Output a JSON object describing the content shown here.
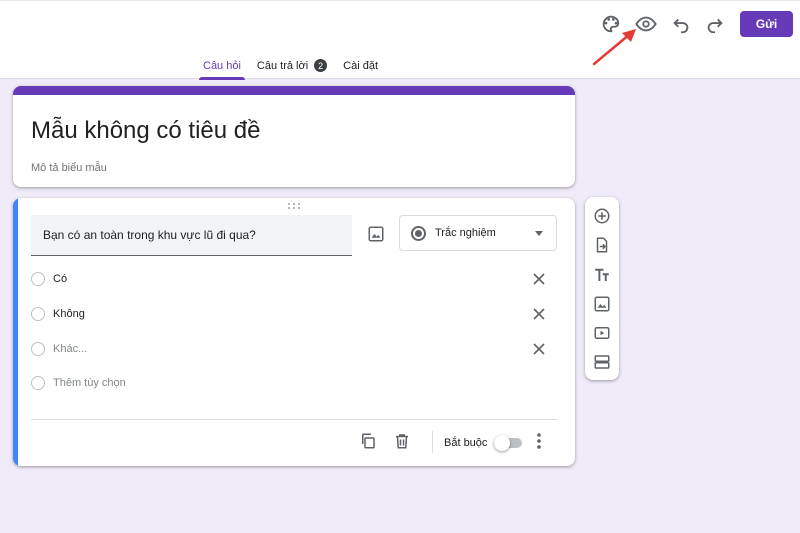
{
  "header": {
    "send_label": "Gửi",
    "tabs": [
      {
        "label": "Câu hỏi",
        "active": true
      },
      {
        "label": "Câu trả lời",
        "badge": "2"
      },
      {
        "label": "Cài đặt"
      }
    ],
    "icons": [
      "palette-icon",
      "eye-icon",
      "undo-icon",
      "redo-icon"
    ]
  },
  "form": {
    "title": "Mẫu không có tiêu đề",
    "description": "Mô tả biểu mẫu"
  },
  "question": {
    "text": "Bạn có an toàn trong khu vực lũ đi qua?",
    "type": "Trắc nghiệm",
    "options": [
      "Có",
      "Không",
      "Khác..."
    ],
    "add_option": "Thêm tùy chọn",
    "required_label": "Bắt buộc",
    "required": false
  },
  "colors": {
    "accent": "#673ab7",
    "focus": "#4285f4",
    "background": "#f0ebf8",
    "annotation_arrow": "#e53935"
  }
}
